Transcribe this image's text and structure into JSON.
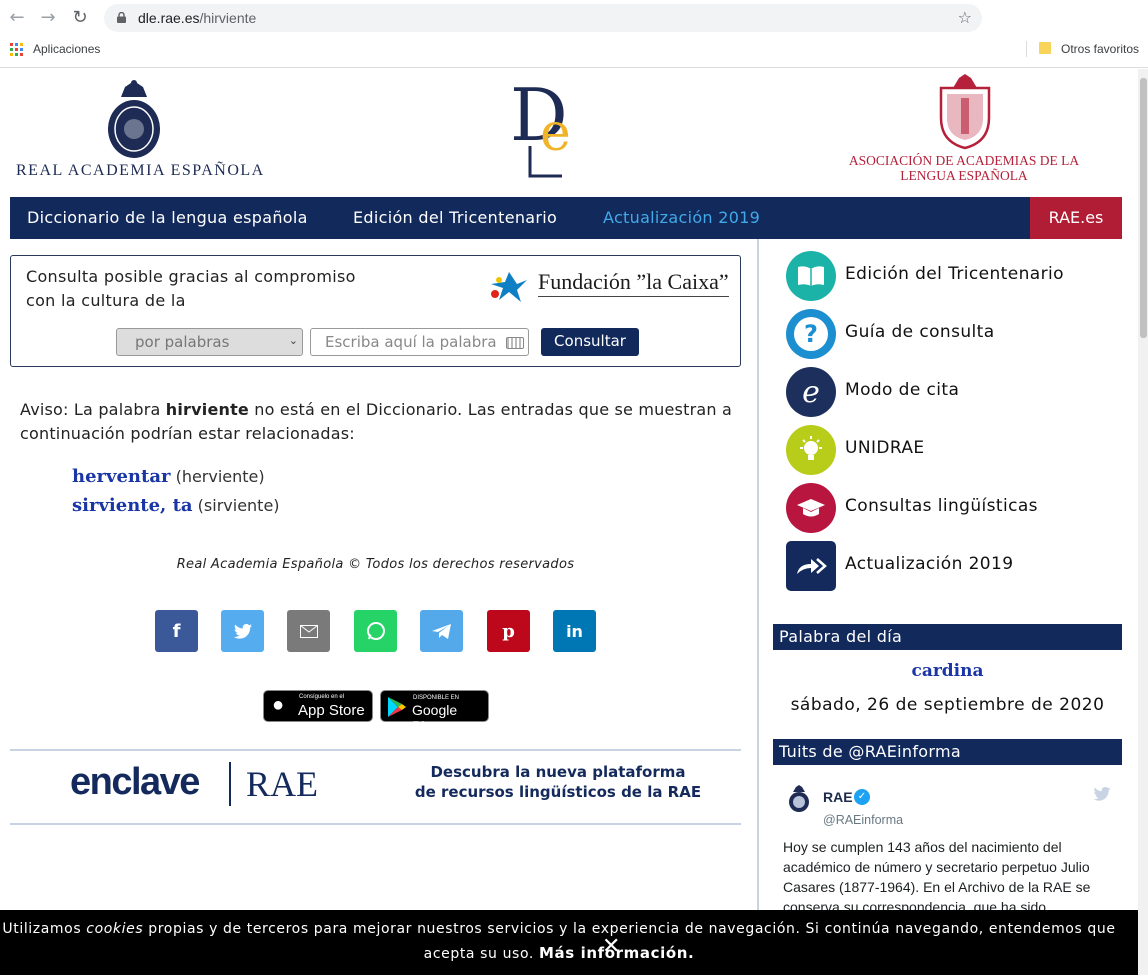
{
  "browser": {
    "url_host": "dle.rae.es",
    "url_path": "/hirviente",
    "bookmarks": {
      "apps": "Aplicaciones",
      "other": "Otros favoritos"
    }
  },
  "header": {
    "rae_name": "REAL ACADEMIA ESPAÑOLA",
    "asale_line1": "ASOCIACIÓN DE ACADEMIAS DE LA",
    "asale_line2": "LENGUA ESPAÑOLA"
  },
  "nav": {
    "diccionario": "Diccionario de la lengua española",
    "tricentenario": "Edición del Tricentenario",
    "actualizacion": "Actualización 2019",
    "rae_es": "RAE.es"
  },
  "consulta": {
    "text_line1": "Consulta posible gracias al compromiso",
    "text_line2": "con la cultura de la",
    "sponsor": "Fundación ”la Caixa”",
    "mode": "por palabras",
    "placeholder": "Escriba aquí la palabra",
    "button": "Consultar"
  },
  "aviso": {
    "prefix": "Aviso: La palabra ",
    "word": "hirviente",
    "suffix": " no está en el Diccionario. Las entradas que se muestran a continuación podrían estar relacionadas:"
  },
  "entries": [
    {
      "lemma": "herventar",
      "form": "(herviente)"
    },
    {
      "lemma": "sirviente, ta",
      "form": "(sirviente)"
    }
  ],
  "copyright": "Real Academia Española © Todos los derechos reservados",
  "stores": {
    "apple_small": "Consíguelo en el",
    "apple": "App Store",
    "google_small": "DISPONIBLE EN",
    "google": "Google Play"
  },
  "enclave": {
    "brand": "enclave",
    "rae": "RAE",
    "line1": "Descubra la nueva plataforma",
    "line2": "de recursos lingüísticos de la RAE"
  },
  "sidebar": [
    {
      "label": "Edición del Tricentenario",
      "color": "#1bb3a8"
    },
    {
      "label": "Guía de consulta",
      "color": "#1c8fd1"
    },
    {
      "label": "Modo de cita",
      "color": "#1d2f5c"
    },
    {
      "label": "UNIDRAE",
      "color": "#b8cc1a"
    },
    {
      "label": "Consultas lingüísticas",
      "color": "#b9163f"
    },
    {
      "label": "Actualización 2019",
      "color": "#142a5c"
    }
  ],
  "palabra_dia": {
    "title": "Palabra del día",
    "word": "cardina",
    "date": "sábado, 26 de septiembre de 2020"
  },
  "tuits": {
    "title": "Tuits de @RAEinforma",
    "name": "RAE",
    "handle": "@RAEinforma",
    "text": "Hoy se cumplen 143 años del nacimiento del académico de número y secretario perpetuo Julio Casares (1877-1964). En el Archivo de la RAE se conserva su correspondencia, que ha sido"
  },
  "cookie": {
    "prefix": "Utilizamos ",
    "cookies": "cookies",
    "text": " propias y de terceros para mejorar nuestros servicios y la experiencia de navegación. Si continúa navegando, entendemos que acepta su uso. ",
    "more": "Más información."
  }
}
